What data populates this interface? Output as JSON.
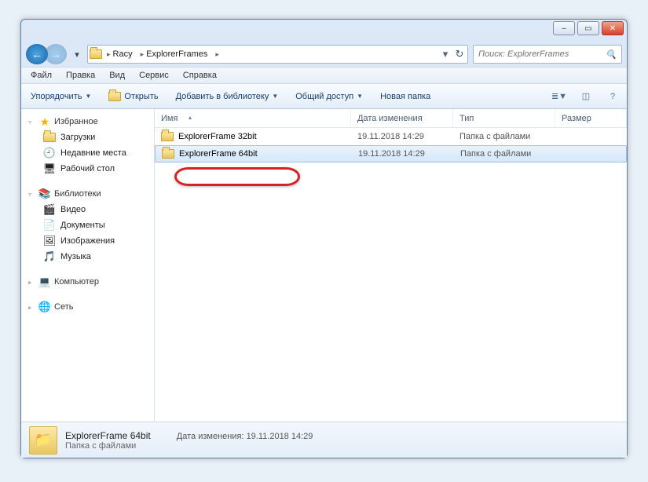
{
  "window_controls": {
    "min": "–",
    "max": "▭",
    "close": "✕"
  },
  "breadcrumbs": [
    "Racy",
    "ExplorerFrames"
  ],
  "search": {
    "placeholder": "Поиск: ExplorerFrames"
  },
  "menu": {
    "file": "Файл",
    "edit": "Правка",
    "view": "Вид",
    "tools": "Сервис",
    "help": "Справка"
  },
  "toolbar": {
    "organize": "Упорядочить",
    "open": "Открыть",
    "library": "Добавить в библиотеку",
    "share": "Общий доступ",
    "newfolder": "Новая папка"
  },
  "sidebar": {
    "favorites": {
      "label": "Избранное",
      "items": [
        "Загрузки",
        "Недавние места",
        "Рабочий стол"
      ]
    },
    "libraries": {
      "label": "Библиотеки",
      "items": [
        "Видео",
        "Документы",
        "Изображения",
        "Музыка"
      ]
    },
    "computer": {
      "label": "Компьютер"
    },
    "network": {
      "label": "Сеть"
    }
  },
  "columns": {
    "name": "Имя",
    "date": "Дата изменения",
    "type": "Тип",
    "size": "Размер"
  },
  "rows": [
    {
      "name": "ExplorerFrame 32bit",
      "date": "19.11.2018 14:29",
      "type": "Папка с файлами",
      "selected": false
    },
    {
      "name": "ExplorerFrame 64bit",
      "date": "19.11.2018 14:29",
      "type": "Папка с файлами",
      "selected": true
    }
  ],
  "status": {
    "title": "ExplorerFrame 64bit",
    "date_label": "Дата изменения:",
    "date_value": "19.11.2018 14:29",
    "sub": "Папка с файлами"
  }
}
